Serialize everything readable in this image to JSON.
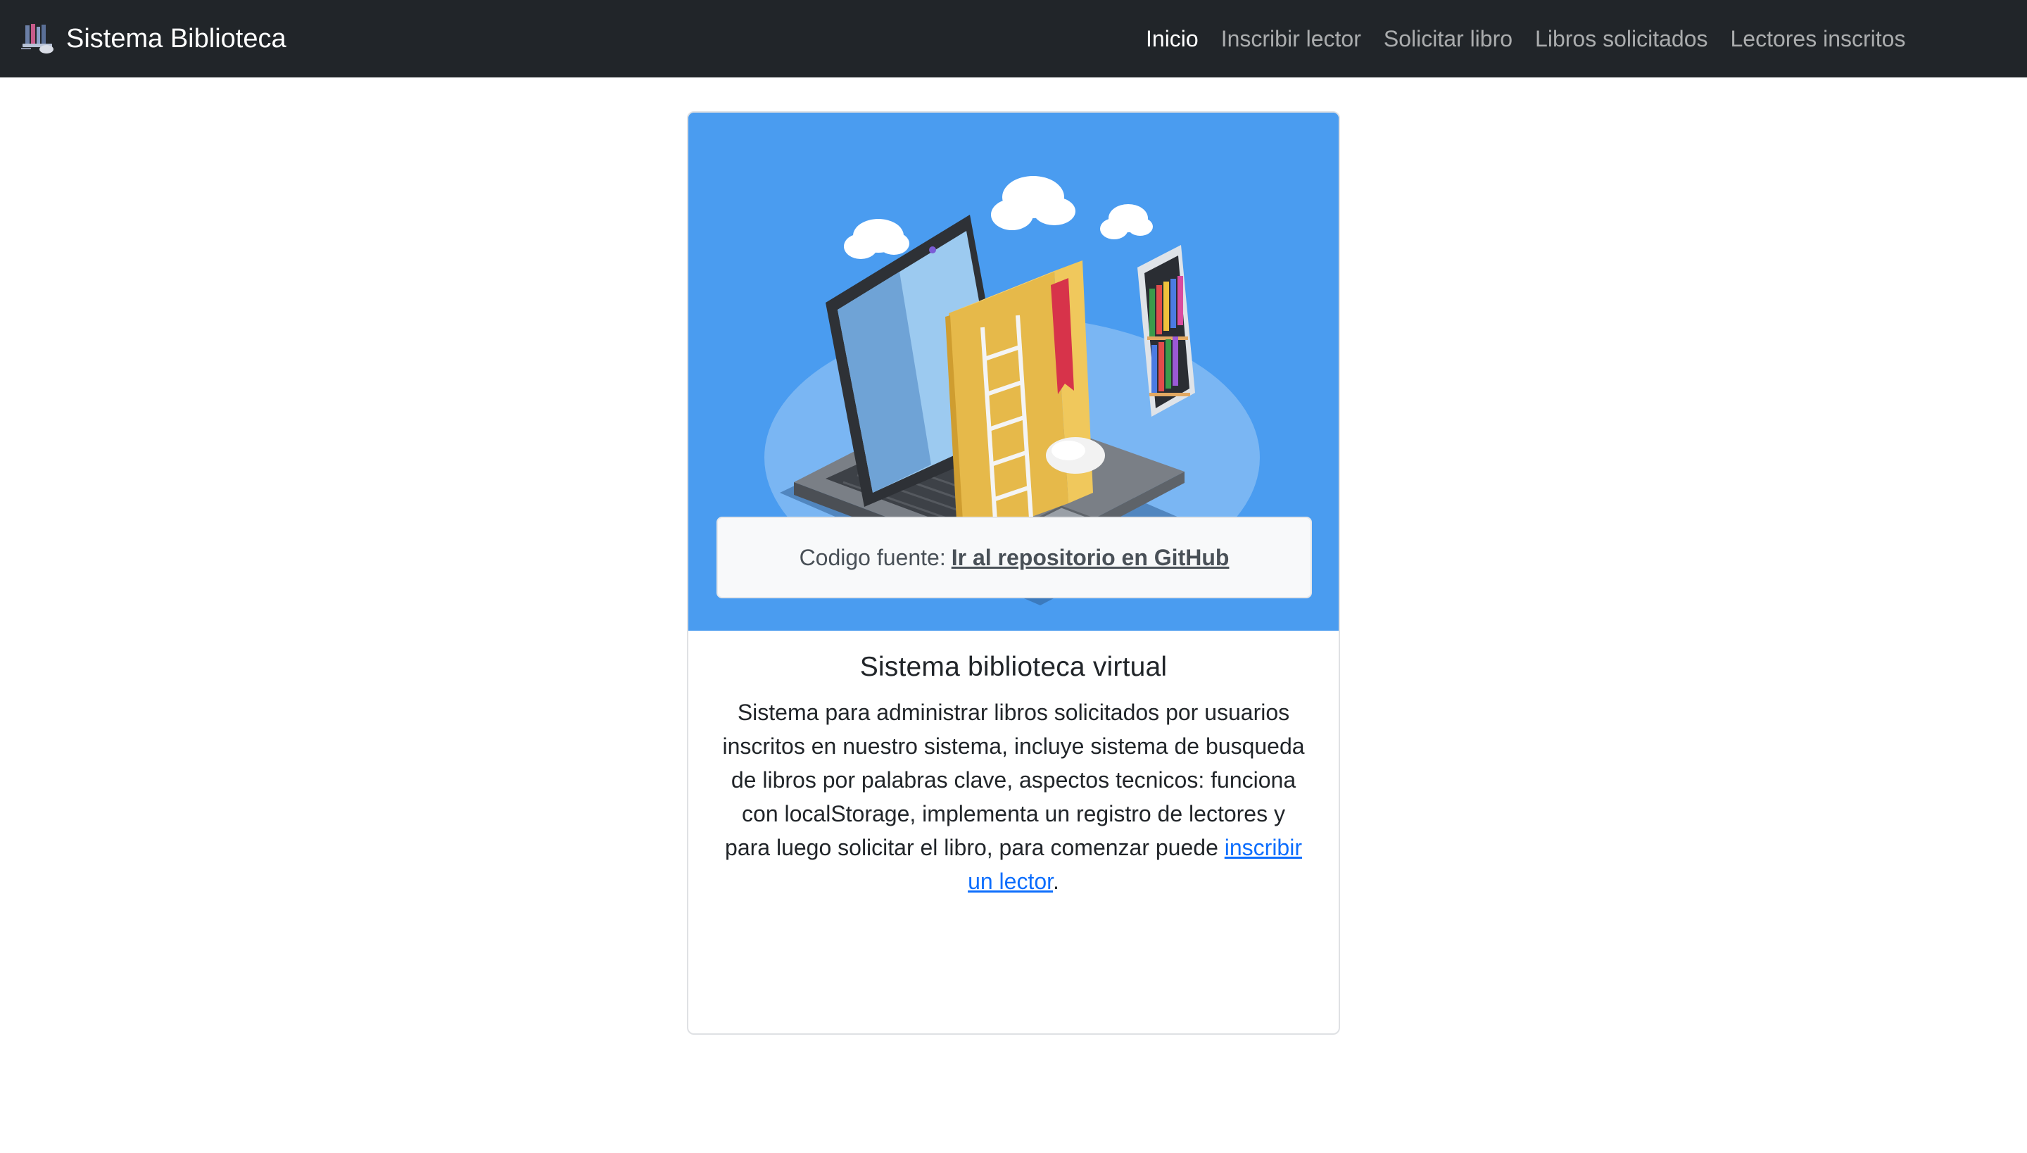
{
  "navbar": {
    "brand": "Sistema Biblioteca",
    "logo_icon": "library-laptop-icon",
    "links": [
      {
        "label": "Inicio",
        "active": true
      },
      {
        "label": "Inscribir lector",
        "active": false
      },
      {
        "label": "Solicitar libro",
        "active": false
      },
      {
        "label": "Libros solicitados",
        "active": false
      },
      {
        "label": "Lectores inscritos",
        "active": false
      }
    ]
  },
  "card": {
    "image_icon": "laptop-books-illustration",
    "title": "Sistema biblioteca virtual",
    "text_before_link": "Sistema para administrar libros solicitados por usuarios inscritos en nuestro sistema, incluye sistema de busqueda de libros por palabras clave, aspectos tecnicos: funciona con localStorage, implementa un registro de lectores y para luego solicitar el libro, para comenzar puede ",
    "link_label": "inscribir un lector",
    "text_after_link": ".",
    "source_label": "Codigo fuente:",
    "source_link_label": "Ir al repositorio en GitHub"
  },
  "colors": {
    "navbar_bg": "#212529",
    "image_bg": "#4a9cf0",
    "link": "#0d6efd"
  }
}
